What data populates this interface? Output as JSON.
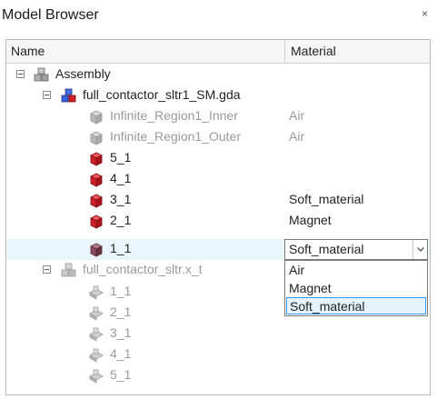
{
  "panel": {
    "title": "Model Browser",
    "close": "×"
  },
  "columns": {
    "name": "Name",
    "material": "Material"
  },
  "tree": {
    "assembly": "Assembly",
    "file1": "full_contactor_sltr1_SM.gda",
    "items1": [
      {
        "label": "Infinite_Region1_Inner",
        "material": "Air"
      },
      {
        "label": "Infinite_Region1_Outer",
        "material": "Air"
      },
      {
        "label": "5_1",
        "material": ""
      },
      {
        "label": "4_1",
        "material": ""
      },
      {
        "label": "3_1",
        "material": "Soft_material"
      },
      {
        "label": "2_1",
        "material": "Magnet"
      },
      {
        "label": "1_1",
        "material": "Soft_material"
      }
    ],
    "file2": "full_contactor_sltr.x_t",
    "items2": [
      "1_1",
      "2_1",
      "3_1",
      "4_1",
      "5_1"
    ]
  },
  "dropdown": {
    "selected": "Soft_material",
    "options": [
      "Air",
      "Magnet",
      "Soft_material"
    ]
  },
  "colors": {
    "solid_red": "#d0202a",
    "selection": "#eaf6fd",
    "highlight_border": "#3399ff"
  }
}
